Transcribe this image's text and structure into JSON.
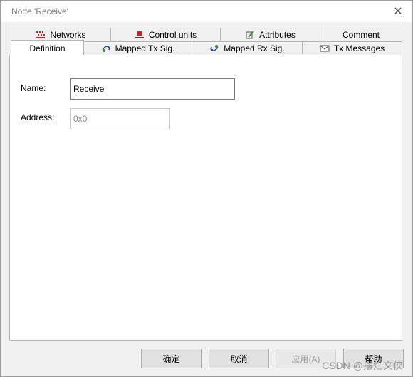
{
  "window": {
    "title": "Node 'Receive'",
    "close_glyph": "✕"
  },
  "tabs": {
    "row1": [
      {
        "label": "Networks",
        "icon": "networks-icon"
      },
      {
        "label": "Control units",
        "icon": "control-units-icon"
      },
      {
        "label": "Attributes",
        "icon": "attributes-icon"
      },
      {
        "label": "Comment",
        "icon": ""
      }
    ],
    "row2": [
      {
        "label": "Definition",
        "icon": "",
        "active": true
      },
      {
        "label": "Mapped Tx Sig.",
        "icon": "mapped-tx-icon"
      },
      {
        "label": "Mapped Rx Sig.",
        "icon": "mapped-rx-icon"
      },
      {
        "label": "Tx Messages",
        "icon": "envelope-icon"
      }
    ]
  },
  "form": {
    "name_label": "Name:",
    "name_value": "Receive",
    "address_label": "Address:",
    "address_value": "0x0"
  },
  "buttons": {
    "ok": "确定",
    "cancel": "取消",
    "apply": "应用(A)",
    "help": "帮助"
  },
  "watermark": "CSDN @摆烂文侠",
  "colors": {
    "networks_icon": "#cc2222",
    "control_units_icon": "#cc2222",
    "attributes_icon": "#3a8a3a",
    "mapped_icon": "#2a4fa0"
  }
}
